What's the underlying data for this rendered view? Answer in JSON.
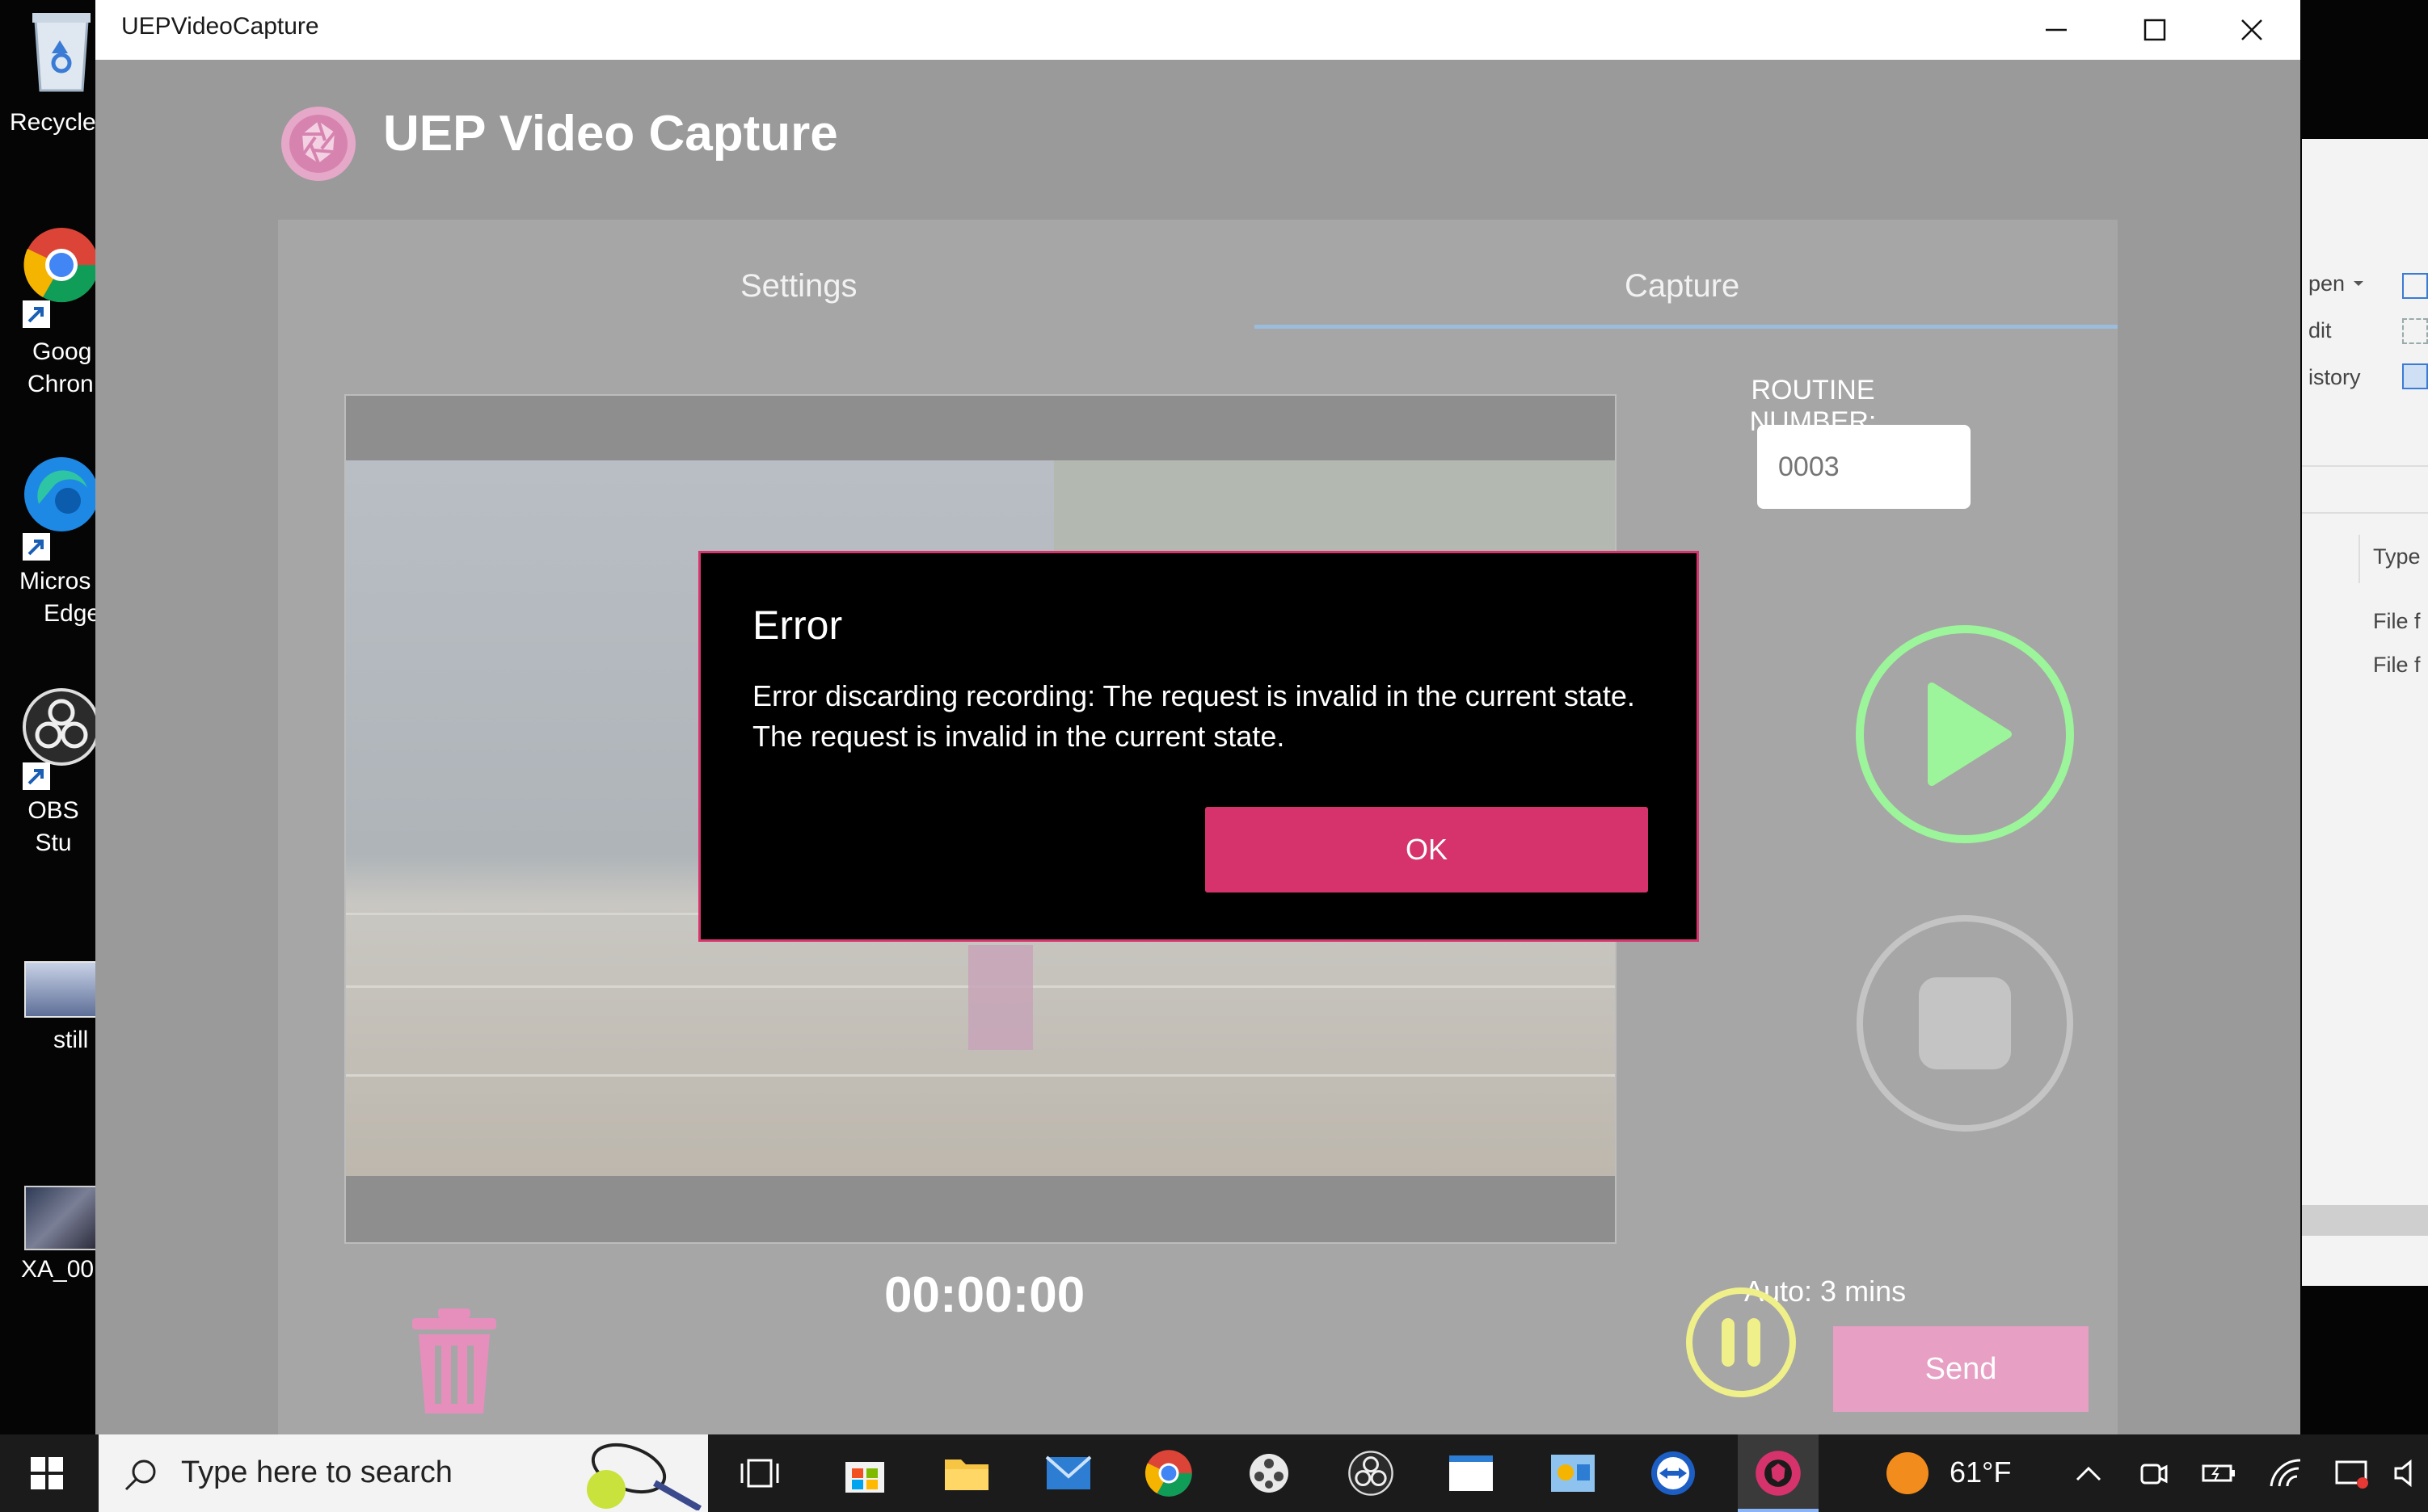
{
  "window": {
    "title": "UEPVideoCapture",
    "minimize_label": "minimize",
    "maximize_label": "maximize",
    "close_label": "close"
  },
  "app": {
    "title": "UEP Video Capture",
    "tabs": [
      {
        "label": "Settings",
        "selected": false
      },
      {
        "label": "Capture",
        "selected": true
      }
    ],
    "routine_label": "ROUTINE NUMBER:",
    "routine_placeholder": "0003",
    "timer": "00:00:00",
    "auto_label": "Auto: 3 mins",
    "send_label": "Send"
  },
  "dialog": {
    "title": "Error",
    "message_line1": "Error discarding recording: The request is invalid in the current state.",
    "message_line2": "The request is invalid in the current state.",
    "ok_label": "OK"
  },
  "desktop_icons": [
    {
      "label": "Recycle",
      "icon": "recycle-bin-icon"
    },
    {
      "label1": "Goog",
      "label2": "Chron",
      "icon": "chrome-icon"
    },
    {
      "label1": "Micros",
      "label2": "Edge",
      "icon": "edge-icon"
    },
    {
      "label": "OBS Stu",
      "icon": "obs-icon"
    },
    {
      "label": "still",
      "icon": "image-thumbnail-icon"
    },
    {
      "label": "XA_00",
      "icon": "video-thumbnail-icon"
    }
  ],
  "background_window": {
    "items": [
      "pen",
      "dit",
      "istory",
      "Type",
      "File f",
      "File f"
    ]
  },
  "taskbar": {
    "search_placeholder": "Type here to search",
    "weather": "61°F"
  },
  "colors": {
    "accent_pink": "#d6336c",
    "play_green": "#9cf59a",
    "pause_yellow": "#f0f08a",
    "tab_underline": "#9cbcdc"
  }
}
